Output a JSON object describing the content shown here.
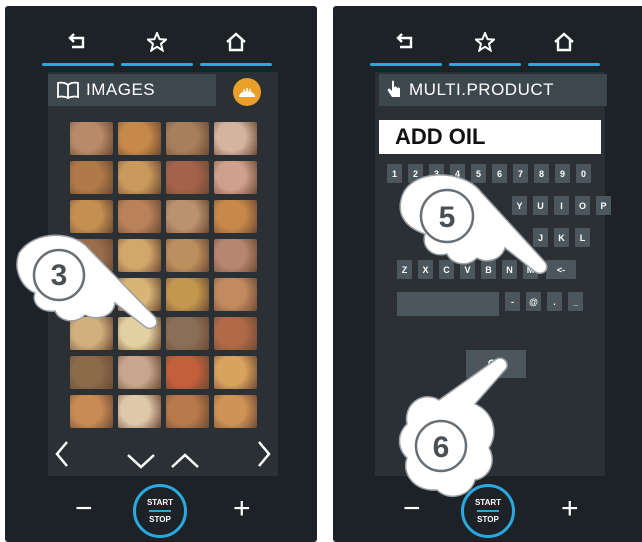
{
  "panel1": {
    "tabs": [
      {
        "icon": "back-arrow-icon"
      },
      {
        "icon": "star-icon"
      },
      {
        "icon": "home-icon"
      }
    ],
    "title": "IMAGES",
    "title_icon": "book-icon",
    "category_icon": "bread-icon",
    "thumbnails": [
      "#b98a6a",
      "#c7894a",
      "#a87f5d",
      "#d2b4a1",
      "#b07a48",
      "#c99a5c",
      "#a5624a",
      "#cfa08b",
      "#c49052",
      "#b9825a",
      "#bb9270",
      "#c7884a",
      "#9a6e4c",
      "#d3a66a",
      "#be8f5e",
      "#b6876e",
      "#c99d62",
      "#d8b475",
      "#c3984e",
      "#c18a5f",
      "#d2b07e",
      "#e2d0a0",
      "#8a6f58",
      "#b06a47",
      "#8c6a4a",
      "#c9a58e",
      "#c45f3b",
      "#d8a25f",
      "#c98b55",
      "#dfc7aa",
      "#b87a4a",
      "#cf9356"
    ],
    "nav_icons": [
      "chevron-left-icon",
      "chevron-down-icon",
      "chevron-up-icon",
      "chevron-right-icon"
    ],
    "callout": "3",
    "minus": "−",
    "plus": "+",
    "start": "START",
    "stop": "STOP"
  },
  "panel2": {
    "tabs": [
      {
        "icon": "back-arrow-icon"
      },
      {
        "icon": "star-icon"
      },
      {
        "icon": "home-icon"
      }
    ],
    "title": "MULTI.PRODUCT",
    "title_icon": "hand-icon",
    "product_name": "ADD OIL",
    "keys_row1": [
      "1",
      "2",
      "3",
      "4",
      "5",
      "6",
      "7",
      "8",
      "9",
      "0"
    ],
    "keys_row2": [
      "Y",
      "U",
      "I",
      "O",
      "P"
    ],
    "keys_row3": [
      "J",
      "K",
      "L"
    ],
    "keys_row4": [
      "Z",
      "X",
      "C",
      "V",
      "B",
      "N",
      "M"
    ],
    "backspace": "<-",
    "keys_row5": [
      "-",
      "@",
      ".",
      "_"
    ],
    "ok": "OK",
    "callout_a": "5",
    "callout_b": "6",
    "minus": "−",
    "plus": "+",
    "start": "START",
    "stop": "STOP"
  },
  "colors": {
    "panel_bg": "#1c2226",
    "screen_bg": "#2a3034",
    "accent": "#2aa9e0",
    "key_bg": "#4b565d",
    "bread_button": "#e8a02b"
  }
}
